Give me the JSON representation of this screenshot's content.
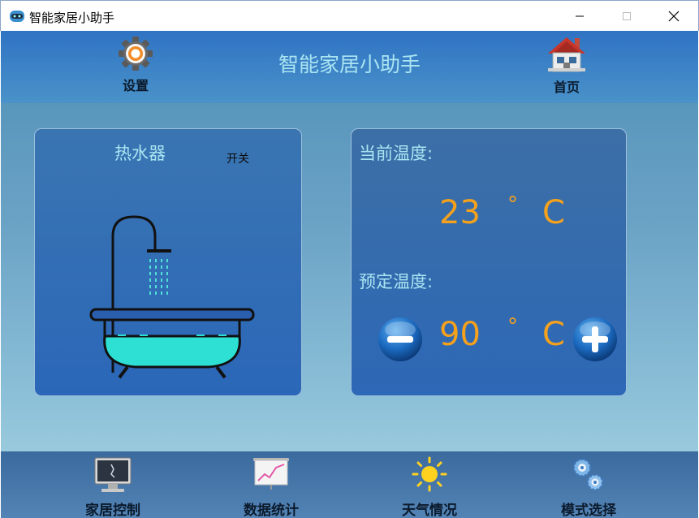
{
  "window": {
    "title": "智能家居小助手",
    "minimize_label": "—",
    "maximize_label": "□",
    "close_label": "✕"
  },
  "header": {
    "title": "智能家居小助手",
    "settings_label": "设置",
    "home_label": "首页"
  },
  "heater": {
    "title": "热水器",
    "switch_label": "开关"
  },
  "temperature": {
    "current_label": "当前温度:",
    "current_value": "23",
    "preset_label": "预定温度:",
    "preset_value": "90",
    "degree_symbol": "°",
    "unit": "C"
  },
  "footer": {
    "items": [
      {
        "label": "家居控制",
        "icon": "monitor-icon"
      },
      {
        "label": "数据统计",
        "icon": "chart-board-icon"
      },
      {
        "label": "天气情况",
        "icon": "sun-icon"
      },
      {
        "label": "模式选择",
        "icon": "gears-icon"
      }
    ]
  },
  "colors": {
    "accent_text": "#a9e4f2",
    "temperature_text": "#f5a11c",
    "water": "#2ee0d4"
  }
}
